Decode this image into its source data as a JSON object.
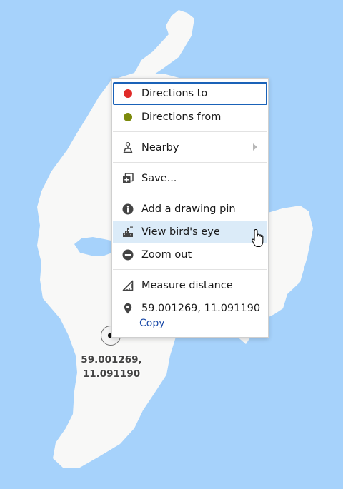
{
  "colors": {
    "water": "#a6d2fb",
    "land": "#f8f8f7",
    "directions_to_dot": "#e02a28",
    "directions_from_dot": "#7c8a0c",
    "focus_border": "#1a62b8",
    "hover_bg": "#dbebf8",
    "link": "#1a4aa8"
  },
  "map": {
    "pin_label_line1": "59.001269,",
    "pin_label_line2": "11.091190"
  },
  "context_menu": {
    "items": [
      {
        "label": "Directions to",
        "icon": "red-dot-icon",
        "state": "focused"
      },
      {
        "label": "Directions from",
        "icon": "olive-dot-icon"
      },
      {
        "label": "Nearby",
        "icon": "person-pin-icon",
        "has_submenu": true
      },
      {
        "label": "Save...",
        "icon": "add-collection-icon"
      },
      {
        "label": "Add a drawing pin",
        "icon": "info-icon"
      },
      {
        "label": "View bird's eye",
        "icon": "birds-eye-icon",
        "state": "hovered"
      },
      {
        "label": "Zoom out",
        "icon": "minus-circle-icon"
      },
      {
        "label": "Measure distance",
        "icon": "ruler-icon"
      },
      {
        "label": "59.001269, 11.091190",
        "icon": "location-pin-icon"
      }
    ],
    "copy_label": "Copy"
  }
}
